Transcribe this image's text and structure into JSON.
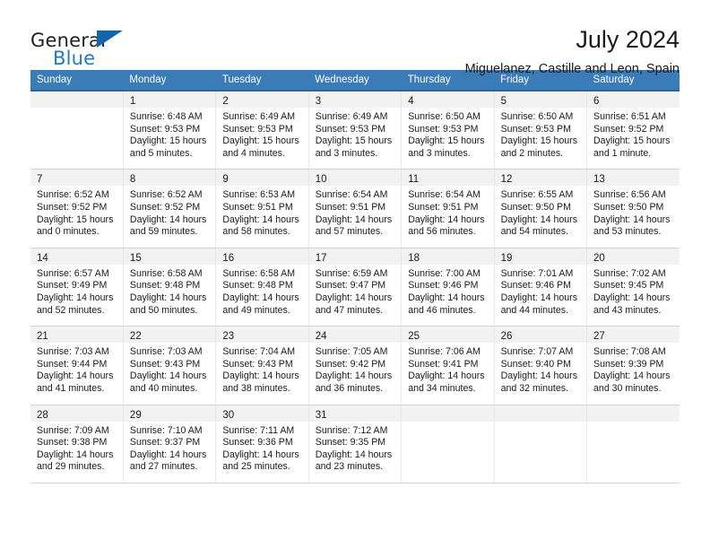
{
  "brand": {
    "name_part1": "General",
    "name_part2": "Blue",
    "flag_icon": "triangle-flag-icon",
    "accent_color": "#1f7ac0"
  },
  "header": {
    "title": "July 2024",
    "subtitle": "Miguelanez, Castille and Leon, Spain"
  },
  "calendar": {
    "header_bg": "#3b7cb8",
    "daynum_bg": "#f2f2f2",
    "weekday_headers": [
      "Sunday",
      "Monday",
      "Tuesday",
      "Wednesday",
      "Thursday",
      "Friday",
      "Saturday"
    ],
    "weeks": [
      [
        {
          "day": "",
          "line1": "",
          "line2": "",
          "line3": "",
          "line4": ""
        },
        {
          "day": "1",
          "line1": "Sunrise: 6:48 AM",
          "line2": "Sunset: 9:53 PM",
          "line3": "Daylight: 15 hours",
          "line4": "and 5 minutes."
        },
        {
          "day": "2",
          "line1": "Sunrise: 6:49 AM",
          "line2": "Sunset: 9:53 PM",
          "line3": "Daylight: 15 hours",
          "line4": "and 4 minutes."
        },
        {
          "day": "3",
          "line1": "Sunrise: 6:49 AM",
          "line2": "Sunset: 9:53 PM",
          "line3": "Daylight: 15 hours",
          "line4": "and 3 minutes."
        },
        {
          "day": "4",
          "line1": "Sunrise: 6:50 AM",
          "line2": "Sunset: 9:53 PM",
          "line3": "Daylight: 15 hours",
          "line4": "and 3 minutes."
        },
        {
          "day": "5",
          "line1": "Sunrise: 6:50 AM",
          "line2": "Sunset: 9:53 PM",
          "line3": "Daylight: 15 hours",
          "line4": "and 2 minutes."
        },
        {
          "day": "6",
          "line1": "Sunrise: 6:51 AM",
          "line2": "Sunset: 9:52 PM",
          "line3": "Daylight: 15 hours",
          "line4": "and 1 minute."
        }
      ],
      [
        {
          "day": "7",
          "line1": "Sunrise: 6:52 AM",
          "line2": "Sunset: 9:52 PM",
          "line3": "Daylight: 15 hours",
          "line4": "and 0 minutes."
        },
        {
          "day": "8",
          "line1": "Sunrise: 6:52 AM",
          "line2": "Sunset: 9:52 PM",
          "line3": "Daylight: 14 hours",
          "line4": "and 59 minutes."
        },
        {
          "day": "9",
          "line1": "Sunrise: 6:53 AM",
          "line2": "Sunset: 9:51 PM",
          "line3": "Daylight: 14 hours",
          "line4": "and 58 minutes."
        },
        {
          "day": "10",
          "line1": "Sunrise: 6:54 AM",
          "line2": "Sunset: 9:51 PM",
          "line3": "Daylight: 14 hours",
          "line4": "and 57 minutes."
        },
        {
          "day": "11",
          "line1": "Sunrise: 6:54 AM",
          "line2": "Sunset: 9:51 PM",
          "line3": "Daylight: 14 hours",
          "line4": "and 56 minutes."
        },
        {
          "day": "12",
          "line1": "Sunrise: 6:55 AM",
          "line2": "Sunset: 9:50 PM",
          "line3": "Daylight: 14 hours",
          "line4": "and 54 minutes."
        },
        {
          "day": "13",
          "line1": "Sunrise: 6:56 AM",
          "line2": "Sunset: 9:50 PM",
          "line3": "Daylight: 14 hours",
          "line4": "and 53 minutes."
        }
      ],
      [
        {
          "day": "14",
          "line1": "Sunrise: 6:57 AM",
          "line2": "Sunset: 9:49 PM",
          "line3": "Daylight: 14 hours",
          "line4": "and 52 minutes."
        },
        {
          "day": "15",
          "line1": "Sunrise: 6:58 AM",
          "line2": "Sunset: 9:48 PM",
          "line3": "Daylight: 14 hours",
          "line4": "and 50 minutes."
        },
        {
          "day": "16",
          "line1": "Sunrise: 6:58 AM",
          "line2": "Sunset: 9:48 PM",
          "line3": "Daylight: 14 hours",
          "line4": "and 49 minutes."
        },
        {
          "day": "17",
          "line1": "Sunrise: 6:59 AM",
          "line2": "Sunset: 9:47 PM",
          "line3": "Daylight: 14 hours",
          "line4": "and 47 minutes."
        },
        {
          "day": "18",
          "line1": "Sunrise: 7:00 AM",
          "line2": "Sunset: 9:46 PM",
          "line3": "Daylight: 14 hours",
          "line4": "and 46 minutes."
        },
        {
          "day": "19",
          "line1": "Sunrise: 7:01 AM",
          "line2": "Sunset: 9:46 PM",
          "line3": "Daylight: 14 hours",
          "line4": "and 44 minutes."
        },
        {
          "day": "20",
          "line1": "Sunrise: 7:02 AM",
          "line2": "Sunset: 9:45 PM",
          "line3": "Daylight: 14 hours",
          "line4": "and 43 minutes."
        }
      ],
      [
        {
          "day": "21",
          "line1": "Sunrise: 7:03 AM",
          "line2": "Sunset: 9:44 PM",
          "line3": "Daylight: 14 hours",
          "line4": "and 41 minutes."
        },
        {
          "day": "22",
          "line1": "Sunrise: 7:03 AM",
          "line2": "Sunset: 9:43 PM",
          "line3": "Daylight: 14 hours",
          "line4": "and 40 minutes."
        },
        {
          "day": "23",
          "line1": "Sunrise: 7:04 AM",
          "line2": "Sunset: 9:43 PM",
          "line3": "Daylight: 14 hours",
          "line4": "and 38 minutes."
        },
        {
          "day": "24",
          "line1": "Sunrise: 7:05 AM",
          "line2": "Sunset: 9:42 PM",
          "line3": "Daylight: 14 hours",
          "line4": "and 36 minutes."
        },
        {
          "day": "25",
          "line1": "Sunrise: 7:06 AM",
          "line2": "Sunset: 9:41 PM",
          "line3": "Daylight: 14 hours",
          "line4": "and 34 minutes."
        },
        {
          "day": "26",
          "line1": "Sunrise: 7:07 AM",
          "line2": "Sunset: 9:40 PM",
          "line3": "Daylight: 14 hours",
          "line4": "and 32 minutes."
        },
        {
          "day": "27",
          "line1": "Sunrise: 7:08 AM",
          "line2": "Sunset: 9:39 PM",
          "line3": "Daylight: 14 hours",
          "line4": "and 30 minutes."
        }
      ],
      [
        {
          "day": "28",
          "line1": "Sunrise: 7:09 AM",
          "line2": "Sunset: 9:38 PM",
          "line3": "Daylight: 14 hours",
          "line4": "and 29 minutes."
        },
        {
          "day": "29",
          "line1": "Sunrise: 7:10 AM",
          "line2": "Sunset: 9:37 PM",
          "line3": "Daylight: 14 hours",
          "line4": "and 27 minutes."
        },
        {
          "day": "30",
          "line1": "Sunrise: 7:11 AM",
          "line2": "Sunset: 9:36 PM",
          "line3": "Daylight: 14 hours",
          "line4": "and 25 minutes."
        },
        {
          "day": "31",
          "line1": "Sunrise: 7:12 AM",
          "line2": "Sunset: 9:35 PM",
          "line3": "Daylight: 14 hours",
          "line4": "and 23 minutes."
        },
        {
          "day": "",
          "line1": "",
          "line2": "",
          "line3": "",
          "line4": ""
        },
        {
          "day": "",
          "line1": "",
          "line2": "",
          "line3": "",
          "line4": ""
        },
        {
          "day": "",
          "line1": "",
          "line2": "",
          "line3": "",
          "line4": ""
        }
      ]
    ]
  }
}
